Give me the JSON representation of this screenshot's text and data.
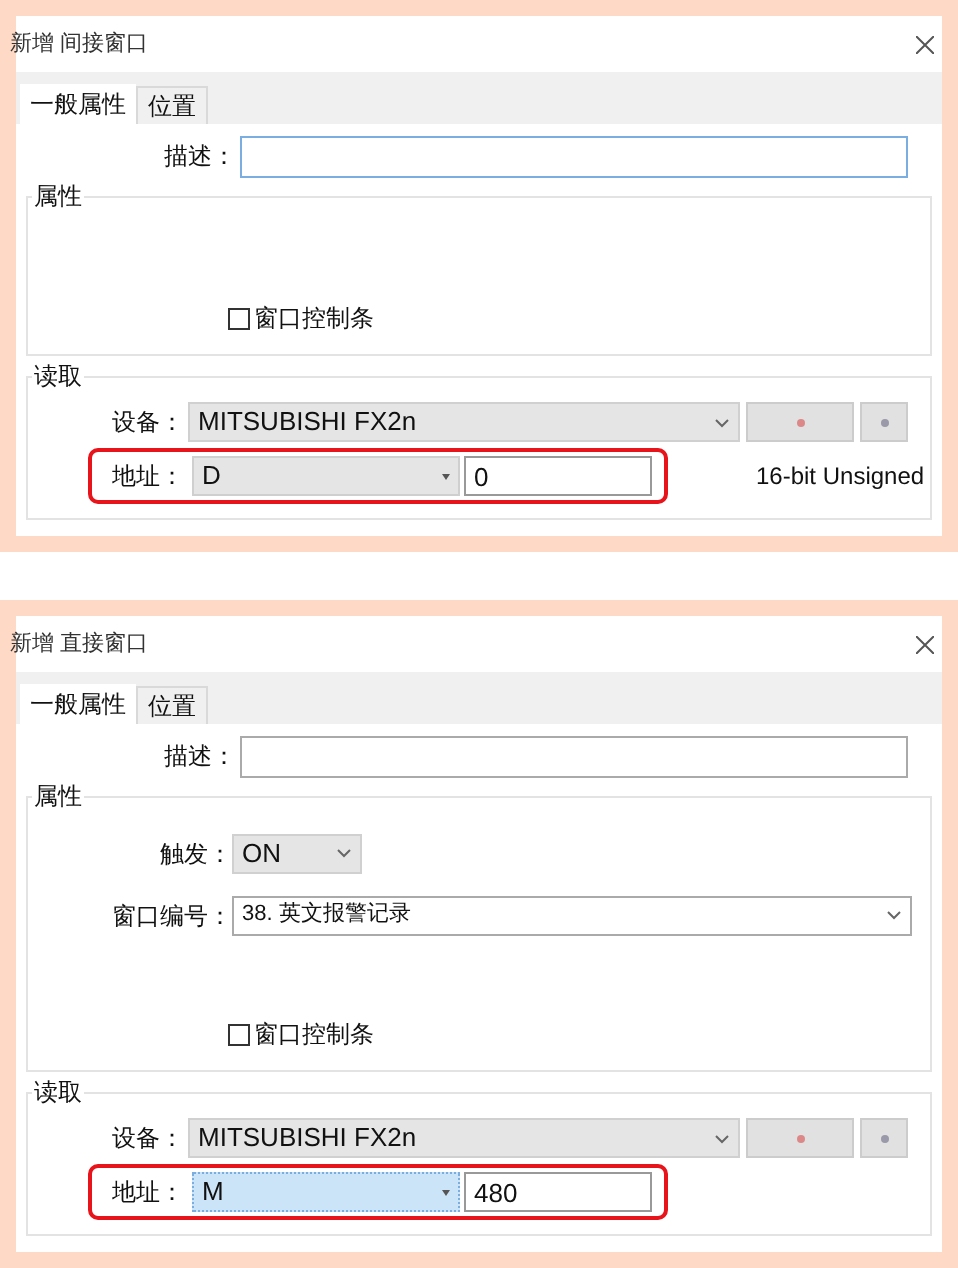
{
  "dialogs": [
    {
      "title": "新增 间接窗口",
      "tabs": [
        {
          "label": "一般属性",
          "selected": true
        },
        {
          "label": "位置",
          "selected": false
        }
      ],
      "description": {
        "label": "描述：",
        "focused": true
      },
      "properties": {
        "title": "属性",
        "checkbox": {
          "label": "窗口控制条",
          "checked": false
        }
      },
      "read": {
        "title": "读取",
        "device": {
          "label": "设备：",
          "value": "MITSUBISHI FX2n"
        },
        "address": {
          "label": "地址：",
          "type": "D",
          "focused": false,
          "value": "0",
          "highlight": true
        },
        "data_type": "16-bit Unsigned"
      }
    },
    {
      "title": "新增 直接窗口",
      "tabs": [
        {
          "label": "一般属性",
          "selected": true
        },
        {
          "label": "位置",
          "selected": false
        }
      ],
      "description": {
        "label": "描述：",
        "focused": false
      },
      "properties": {
        "title": "属性",
        "fields": [
          {
            "label": "触发：",
            "value": "ON",
            "kind": "small"
          },
          {
            "label": "窗口编号：",
            "value": "38. 英文报警记录",
            "kind": "wide"
          }
        ],
        "checkbox": {
          "label": "窗口控制条",
          "checked": false
        }
      },
      "read": {
        "title": "读取",
        "device": {
          "label": "设备：",
          "value": "MITSUBISHI FX2n"
        },
        "address": {
          "label": "地址：",
          "type": "M",
          "focused": true,
          "value": "480",
          "highlight": true
        }
      }
    }
  ]
}
